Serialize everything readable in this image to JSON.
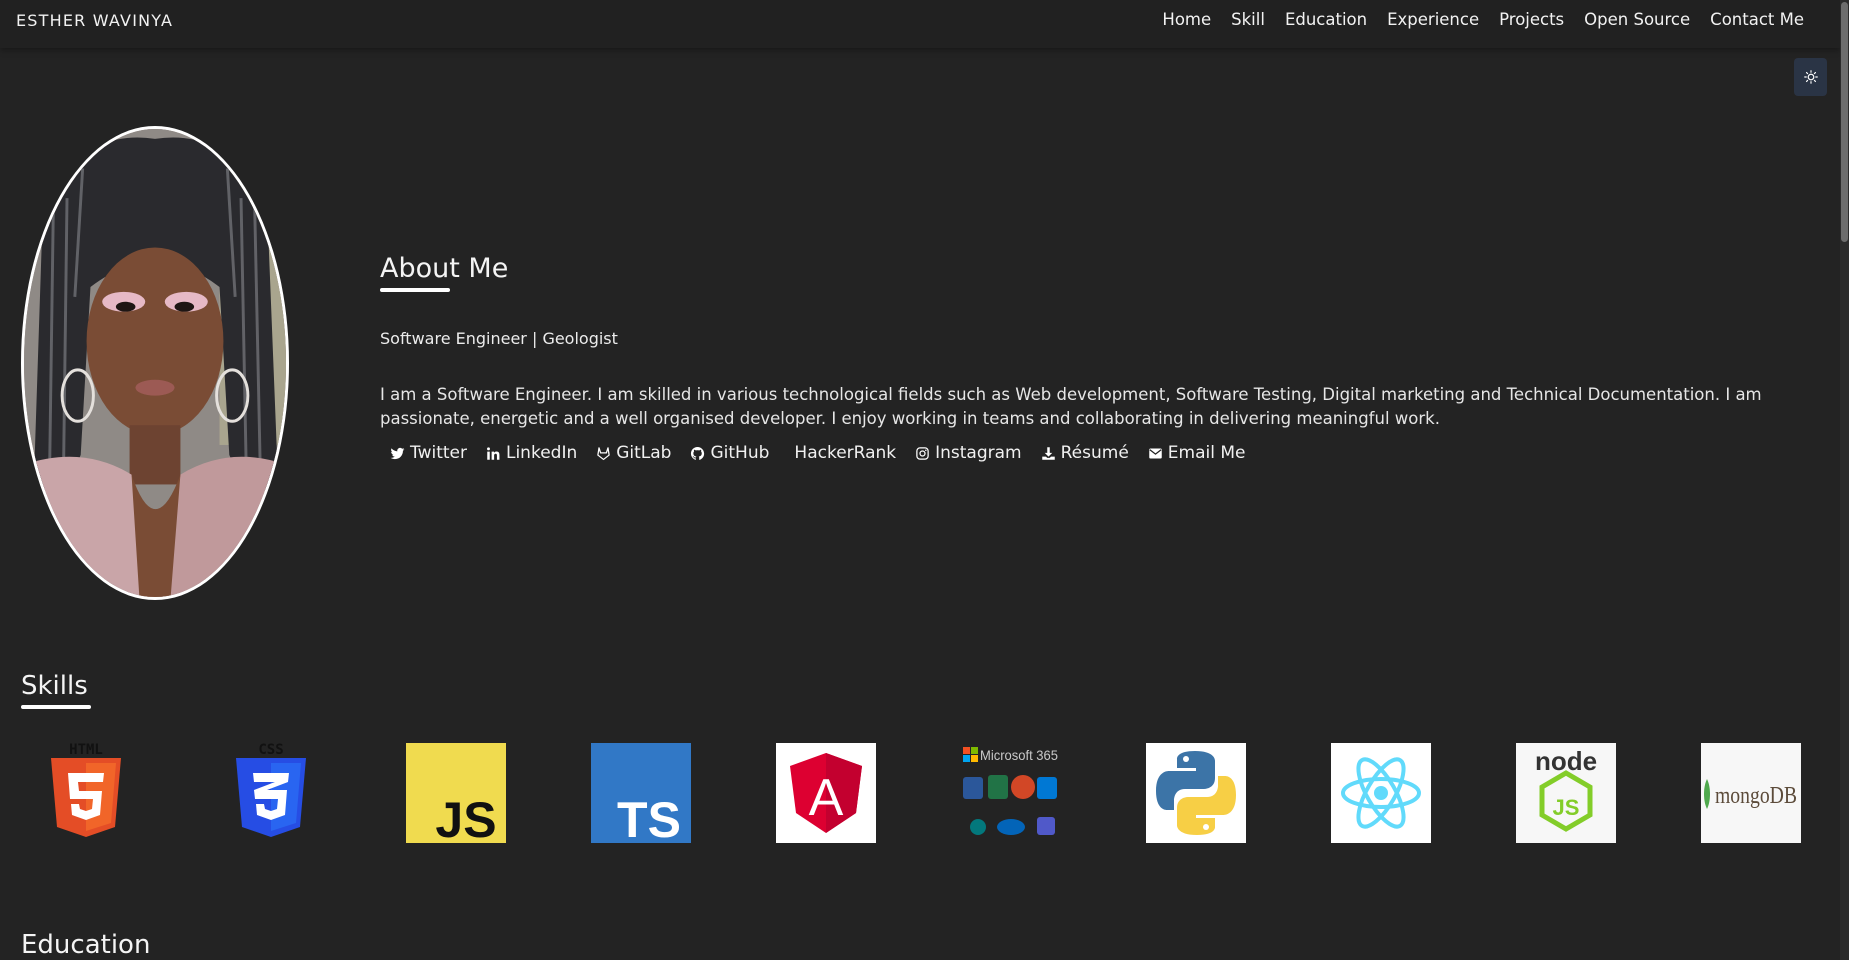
{
  "brand": "ESTHER WAVINYA",
  "nav": {
    "items": [
      {
        "label": "Home"
      },
      {
        "label": "Skill"
      },
      {
        "label": "Education"
      },
      {
        "label": "Experience"
      },
      {
        "label": "Projects"
      },
      {
        "label": "Open Source"
      },
      {
        "label": "Contact Me"
      }
    ]
  },
  "theme_toggle": {
    "icon": "sun-icon"
  },
  "about": {
    "title": "About Me",
    "subtitle": "Software Engineer | Geologist",
    "description": "I am a Software Engineer. I am skilled in various technological fields such as Web development, Software Testing, Digital marketing and Technical Documentation. I am passionate, energetic and a well organised developer. I enjoy working in teams and collaborating in delivering meaningful work.",
    "links": [
      {
        "label": "Twitter",
        "icon": "twitter-icon"
      },
      {
        "label": "LinkedIn",
        "icon": "linkedin-icon"
      },
      {
        "label": "GitLab",
        "icon": "gitlab-icon"
      },
      {
        "label": "GitHub",
        "icon": "github-icon"
      },
      {
        "label": "HackerRank",
        "icon": ""
      },
      {
        "label": "Instagram",
        "icon": "instagram-icon"
      },
      {
        "label": "Résumé",
        "icon": "download-icon"
      },
      {
        "label": "Email Me",
        "icon": "envelope-icon"
      }
    ]
  },
  "skills": {
    "title": "Skills",
    "items": [
      {
        "icon": "html5-logo-icon",
        "text": "HTML"
      },
      {
        "icon": "css3-logo-icon",
        "text": "CSS"
      },
      {
        "icon": "javascript-logo-icon",
        "text": "JS"
      },
      {
        "icon": "typescript-logo-icon",
        "text": "TS"
      },
      {
        "icon": "angular-logo-icon",
        "text": "A"
      },
      {
        "icon": "microsoft-365-logo-icon",
        "text": "Microsoft 365"
      },
      {
        "icon": "python-logo-icon",
        "text": ""
      },
      {
        "icon": "react-logo-icon",
        "text": ""
      },
      {
        "icon": "nodejs-logo-icon",
        "text": "node"
      },
      {
        "icon": "mongodb-logo-icon",
        "text": "mongoDB"
      }
    ]
  },
  "education": {
    "title": "Education"
  },
  "colors": {
    "background": "#232323",
    "navbar": "#212121",
    "text": "#e9e9e9",
    "toggle": "#2a3445",
    "html5": "#e44d26",
    "css3": "#264de4",
    "js": "#f0db4f",
    "ts": "#3178c6",
    "angular": "#dd0031",
    "python_blue": "#3c74a7",
    "python_yellow": "#f7cf45",
    "react": "#61dafb",
    "node": "#83cd29",
    "mongodb": "#4fa94d"
  }
}
